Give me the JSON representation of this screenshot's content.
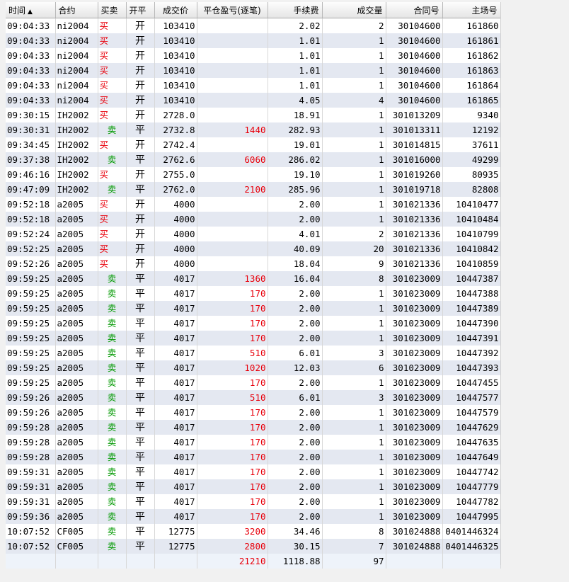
{
  "columns": {
    "time": "时间",
    "contract": "合约",
    "side": "买卖",
    "open_close": "开平",
    "price": "成交价",
    "pnl": "平仓盈亏(逐笔)",
    "fee": "手续费",
    "volume": "成交量",
    "contract_no": "合同号",
    "match_no": "主场号"
  },
  "sort_indicator": "▲",
  "rows": [
    [
      "09:04:33",
      "ni2004",
      "买",
      "开",
      "103410",
      "",
      "2.02",
      "2",
      "30104600",
      "161860"
    ],
    [
      "09:04:33",
      "ni2004",
      "买",
      "开",
      "103410",
      "",
      "1.01",
      "1",
      "30104600",
      "161861"
    ],
    [
      "09:04:33",
      "ni2004",
      "买",
      "开",
      "103410",
      "",
      "1.01",
      "1",
      "30104600",
      "161862"
    ],
    [
      "09:04:33",
      "ni2004",
      "买",
      "开",
      "103410",
      "",
      "1.01",
      "1",
      "30104600",
      "161863"
    ],
    [
      "09:04:33",
      "ni2004",
      "买",
      "开",
      "103410",
      "",
      "1.01",
      "1",
      "30104600",
      "161864"
    ],
    [
      "09:04:33",
      "ni2004",
      "买",
      "开",
      "103410",
      "",
      "4.05",
      "4",
      "30104600",
      "161865"
    ],
    [
      "09:30:15",
      "IH2002",
      "买",
      "开",
      "2728.0",
      "",
      "18.91",
      "1",
      "301013209",
      "9340"
    ],
    [
      "09:30:31",
      "IH2002",
      "卖",
      "平",
      "2732.8",
      "1440",
      "282.93",
      "1",
      "301013311",
      "12192"
    ],
    [
      "09:34:45",
      "IH2002",
      "买",
      "开",
      "2742.4",
      "",
      "19.01",
      "1",
      "301014815",
      "37611"
    ],
    [
      "09:37:38",
      "IH2002",
      "卖",
      "平",
      "2762.6",
      "6060",
      "286.02",
      "1",
      "301016000",
      "49299"
    ],
    [
      "09:46:16",
      "IH2002",
      "买",
      "开",
      "2755.0",
      "",
      "19.10",
      "1",
      "301019260",
      "80935"
    ],
    [
      "09:47:09",
      "IH2002",
      "卖",
      "平",
      "2762.0",
      "2100",
      "285.96",
      "1",
      "301019718",
      "82808"
    ],
    [
      "09:52:18",
      "a2005",
      "买",
      "开",
      "4000",
      "",
      "2.00",
      "1",
      "301021336",
      "10410477"
    ],
    [
      "09:52:18",
      "a2005",
      "买",
      "开",
      "4000",
      "",
      "2.00",
      "1",
      "301021336",
      "10410484"
    ],
    [
      "09:52:24",
      "a2005",
      "买",
      "开",
      "4000",
      "",
      "4.01",
      "2",
      "301021336",
      "10410799"
    ],
    [
      "09:52:25",
      "a2005",
      "买",
      "开",
      "4000",
      "",
      "40.09",
      "20",
      "301021336",
      "10410842"
    ],
    [
      "09:52:26",
      "a2005",
      "买",
      "开",
      "4000",
      "",
      "18.04",
      "9",
      "301021336",
      "10410859"
    ],
    [
      "09:59:25",
      "a2005",
      "卖",
      "平",
      "4017",
      "1360",
      "16.04",
      "8",
      "301023009",
      "10447387"
    ],
    [
      "09:59:25",
      "a2005",
      "卖",
      "平",
      "4017",
      "170",
      "2.00",
      "1",
      "301023009",
      "10447388"
    ],
    [
      "09:59:25",
      "a2005",
      "卖",
      "平",
      "4017",
      "170",
      "2.00",
      "1",
      "301023009",
      "10447389"
    ],
    [
      "09:59:25",
      "a2005",
      "卖",
      "平",
      "4017",
      "170",
      "2.00",
      "1",
      "301023009",
      "10447390"
    ],
    [
      "09:59:25",
      "a2005",
      "卖",
      "平",
      "4017",
      "170",
      "2.00",
      "1",
      "301023009",
      "10447391"
    ],
    [
      "09:59:25",
      "a2005",
      "卖",
      "平",
      "4017",
      "510",
      "6.01",
      "3",
      "301023009",
      "10447392"
    ],
    [
      "09:59:25",
      "a2005",
      "卖",
      "平",
      "4017",
      "1020",
      "12.03",
      "6",
      "301023009",
      "10447393"
    ],
    [
      "09:59:25",
      "a2005",
      "卖",
      "平",
      "4017",
      "170",
      "2.00",
      "1",
      "301023009",
      "10447455"
    ],
    [
      "09:59:26",
      "a2005",
      "卖",
      "平",
      "4017",
      "510",
      "6.01",
      "3",
      "301023009",
      "10447577"
    ],
    [
      "09:59:26",
      "a2005",
      "卖",
      "平",
      "4017",
      "170",
      "2.00",
      "1",
      "301023009",
      "10447579"
    ],
    [
      "09:59:28",
      "a2005",
      "卖",
      "平",
      "4017",
      "170",
      "2.00",
      "1",
      "301023009",
      "10447629"
    ],
    [
      "09:59:28",
      "a2005",
      "卖",
      "平",
      "4017",
      "170",
      "2.00",
      "1",
      "301023009",
      "10447635"
    ],
    [
      "09:59:28",
      "a2005",
      "卖",
      "平",
      "4017",
      "170",
      "2.00",
      "1",
      "301023009",
      "10447649"
    ],
    [
      "09:59:31",
      "a2005",
      "卖",
      "平",
      "4017",
      "170",
      "2.00",
      "1",
      "301023009",
      "10447742"
    ],
    [
      "09:59:31",
      "a2005",
      "卖",
      "平",
      "4017",
      "170",
      "2.00",
      "1",
      "301023009",
      "10447779"
    ],
    [
      "09:59:31",
      "a2005",
      "卖",
      "平",
      "4017",
      "170",
      "2.00",
      "1",
      "301023009",
      "10447782"
    ],
    [
      "09:59:36",
      "a2005",
      "卖",
      "平",
      "4017",
      "170",
      "2.00",
      "1",
      "301023009",
      "10447995"
    ],
    [
      "10:07:52",
      "CF005",
      "卖",
      "平",
      "12775",
      "3200",
      "34.46",
      "8",
      "301024888",
      "0401446324"
    ],
    [
      "10:07:52",
      "CF005",
      "卖",
      "平",
      "12775",
      "2800",
      "30.15",
      "7",
      "301024888",
      "0401446325"
    ]
  ],
  "totals": {
    "pnl": "21210",
    "fee": "1118.88",
    "volume": "97"
  },
  "colors": {
    "buy": "#e8000b",
    "sell": "#009900",
    "pnl": "#e8000b",
    "row_alt": "#e4e8f1"
  }
}
